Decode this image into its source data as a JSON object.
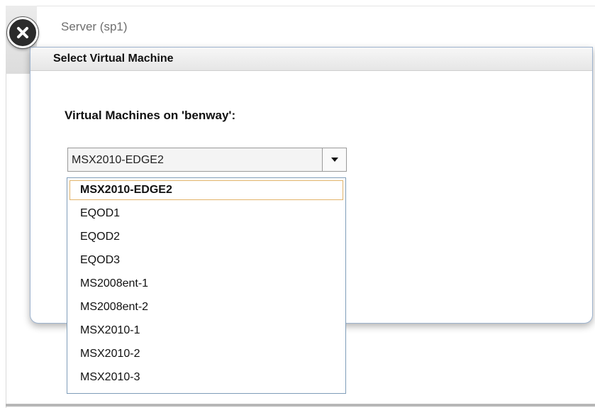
{
  "background_window": {
    "title": "Server (sp1)"
  },
  "dialog": {
    "title": "Select Virtual Machine",
    "vm_label": "Virtual Machines on 'benway':",
    "combo": {
      "selected_value": "MSX2010-EDGE2",
      "arrow_icon": "chevron-down-icon"
    },
    "dropdown": {
      "items": [
        {
          "label": "MSX2010-EDGE2",
          "selected": true
        },
        {
          "label": "EQOD1"
        },
        {
          "label": "EQOD2"
        },
        {
          "label": "EQOD3"
        },
        {
          "label": "MS2008ent-1"
        },
        {
          "label": "MS2008ent-2"
        },
        {
          "label": "MSX2010-1"
        },
        {
          "label": "MSX2010-2"
        },
        {
          "label": "MSX2010-3"
        }
      ]
    },
    "close_icon": "close-icon"
  },
  "colors": {
    "dialog_border": "#9fb4cf",
    "selected_item_border": "#e2b46a",
    "dropdown_border": "#7f9db9"
  }
}
